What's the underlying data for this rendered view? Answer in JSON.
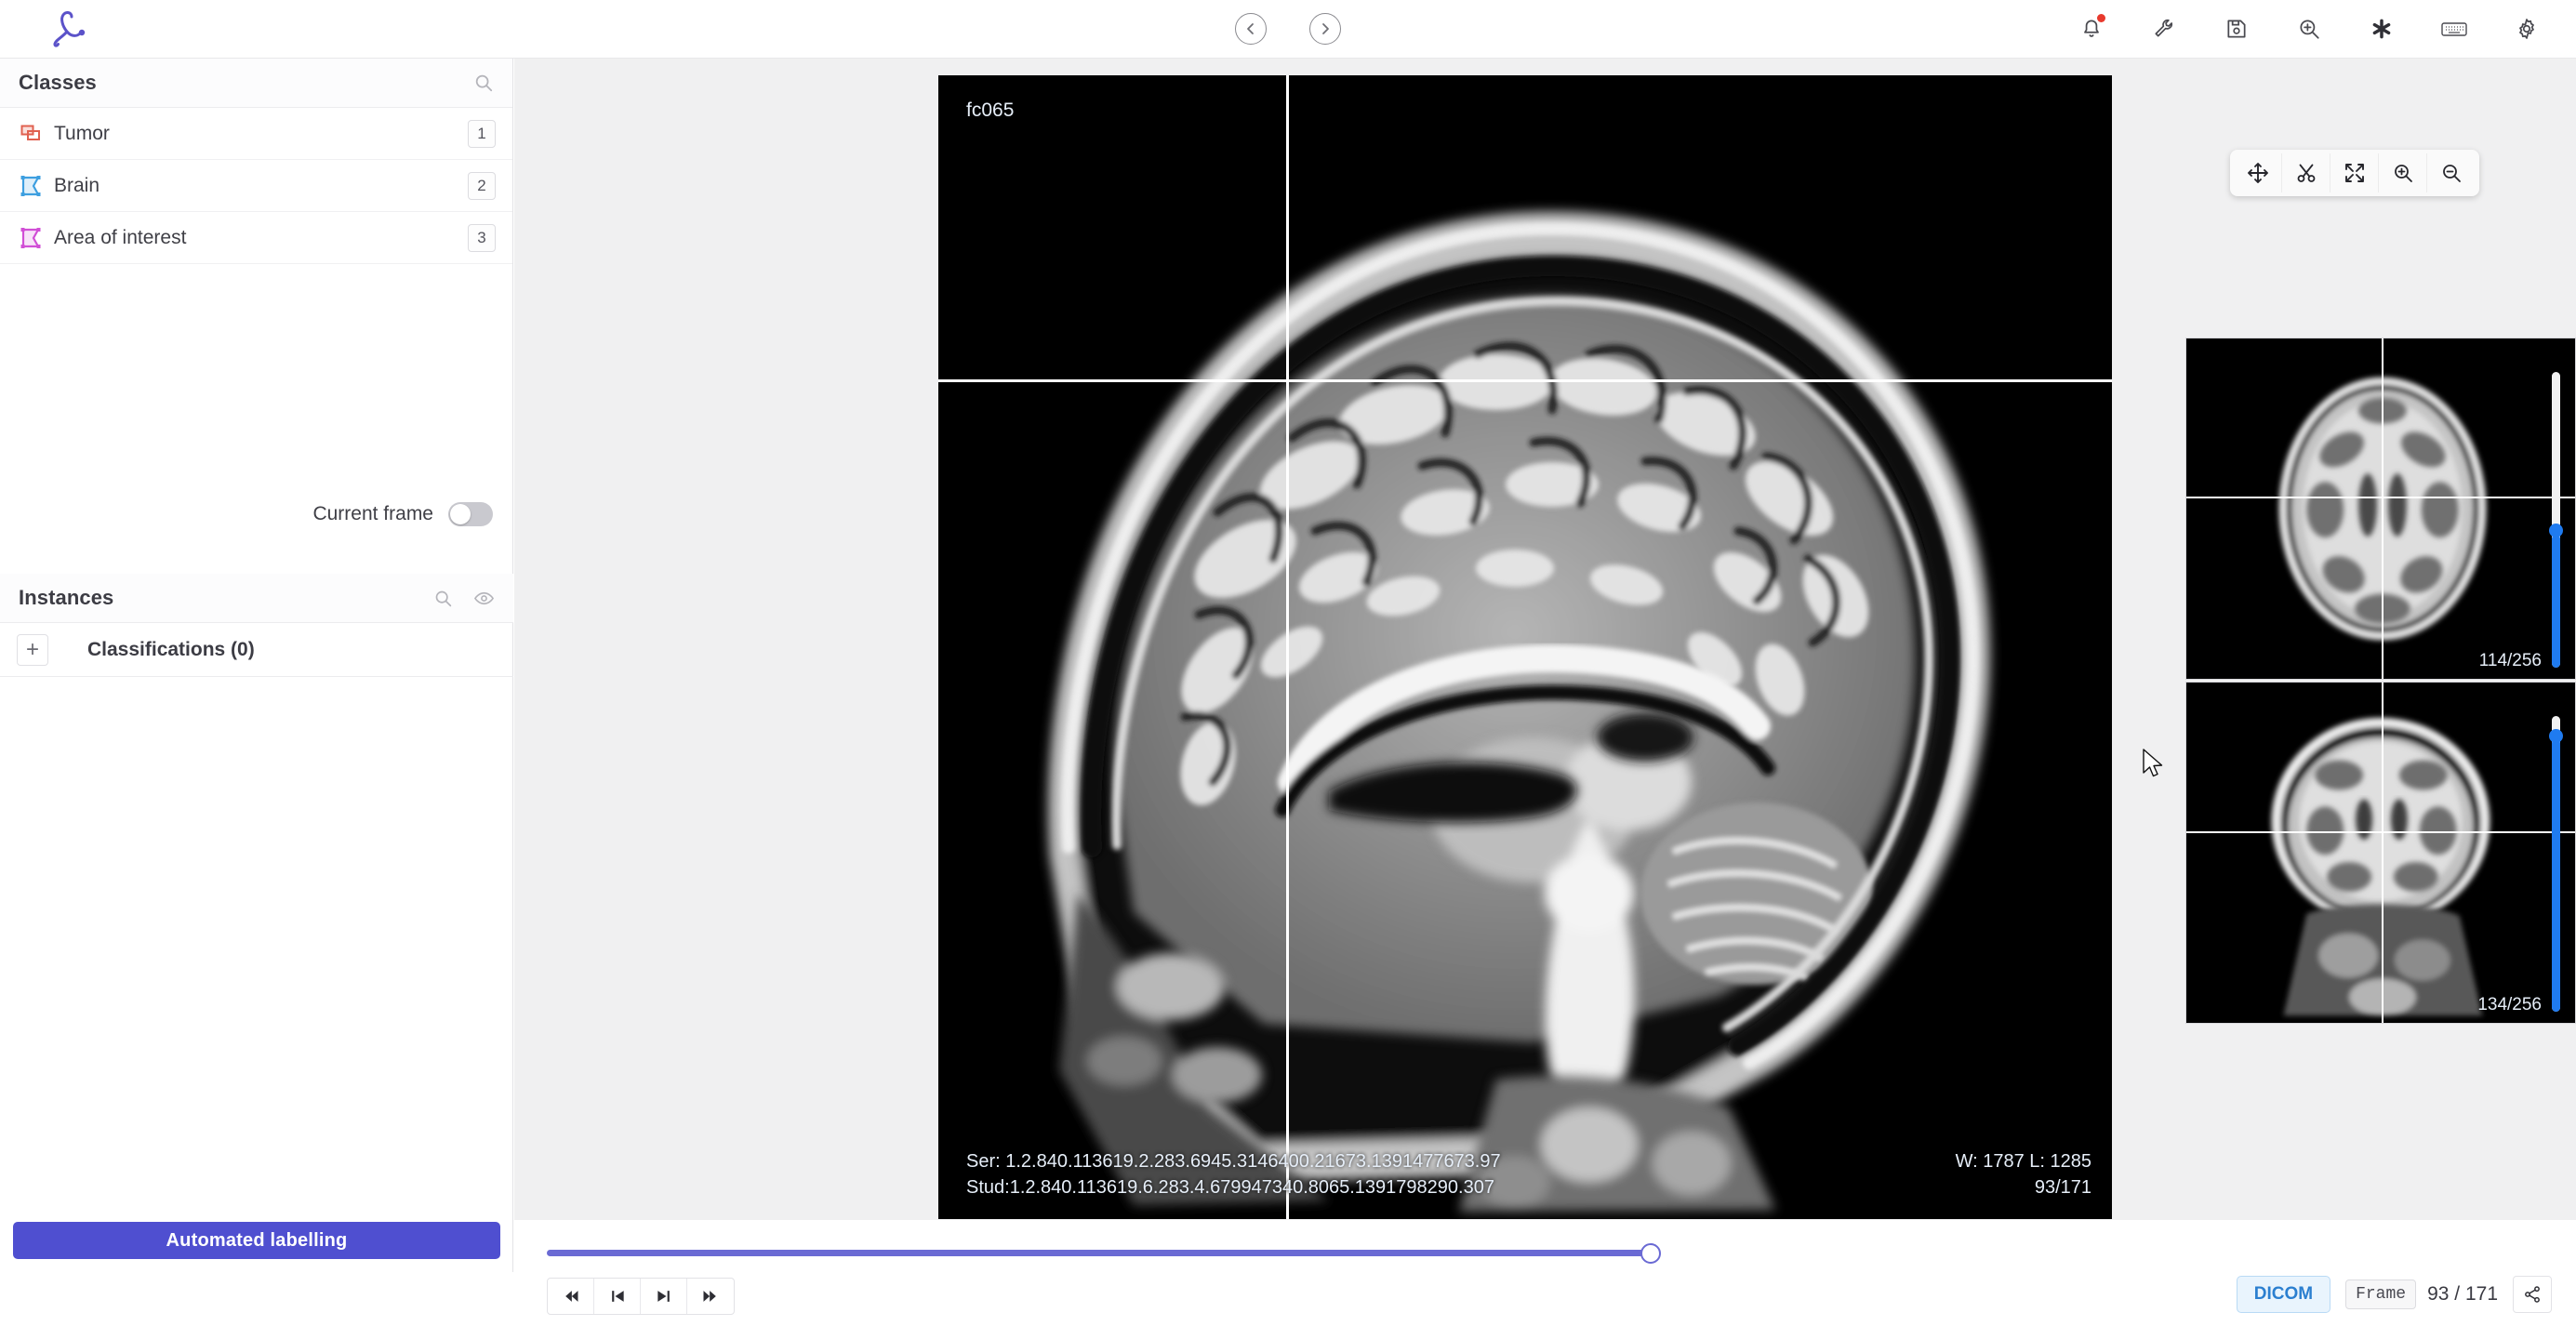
{
  "app": {
    "logo_name": "encord-logo",
    "accent_purple": "#4f4fd0",
    "accent_blue": "#1f7bf0",
    "chip_blue": "#2b7fd0"
  },
  "topbar": {
    "nav_prev_icon": "chevron-left-circle-icon",
    "nav_next_icon": "chevron-right-circle-icon",
    "icons": [
      {
        "name": "bell-icon",
        "has_badge": true
      },
      {
        "name": "wrench-icon",
        "has_badge": false
      },
      {
        "name": "save-icon",
        "has_badge": false
      },
      {
        "name": "zoom-in-icon",
        "has_badge": false
      },
      {
        "name": "asterisk-icon",
        "has_badge": false
      },
      {
        "name": "keyboard-icon",
        "has_badge": false
      },
      {
        "name": "gear-icon",
        "has_badge": false
      }
    ]
  },
  "sidebar": {
    "classes": {
      "title": "Classes",
      "search_icon": "search-icon",
      "items": [
        {
          "label": "Tumor",
          "count": "1",
          "icon": "bounding-box-icon",
          "color": "#e0604f"
        },
        {
          "label": "Brain",
          "count": "2",
          "icon": "polygon-icon",
          "color": "#3d9fe0"
        },
        {
          "label": "Area of interest",
          "count": "3",
          "icon": "polygon-icon",
          "color": "#d14fd6"
        }
      ]
    },
    "current_frame": {
      "label": "Current frame",
      "enabled": false
    },
    "instances": {
      "title": "Instances",
      "search_icon": "search-icon",
      "visibility_icon": "eye-icon",
      "add_icon": "plus-icon",
      "classifications_label": "Classifications (0)"
    },
    "automated_labelling_label": "Automated labelling"
  },
  "viewer": {
    "image_label": "fc065",
    "series_uid": "Ser: 1.2.840.113619.2.283.6945.3146400.21673.1391477673.97",
    "study_uid": "Stud:1.2.840.113619.6.283.4.679947340.8065.1391798290.307",
    "window_level": "W: 1787 L: 1285",
    "slice_counter": "93/171",
    "tools": [
      {
        "name": "move-icon",
        "label": "Move"
      },
      {
        "name": "scissors-icon",
        "label": "Cut"
      },
      {
        "name": "fit-screen-icon",
        "label": "Fit"
      },
      {
        "name": "zoom-in-icon",
        "label": "Zoom in"
      },
      {
        "name": "zoom-out-icon",
        "label": "Zoom out"
      }
    ]
  },
  "thumbnails": [
    {
      "name": "axial-thumbnail",
      "counter": "114/256",
      "slider_percent": 45
    },
    {
      "name": "coronal-thumbnail",
      "counter": "134/256",
      "slider_percent": 92
    }
  ],
  "bottombar": {
    "timeline_percent": 55,
    "transport": [
      {
        "name": "skip-to-start-button",
        "icon": "skip-back-icon"
      },
      {
        "name": "previous-frame-button",
        "icon": "step-back-icon"
      },
      {
        "name": "next-frame-button",
        "icon": "step-forward-icon"
      },
      {
        "name": "skip-to-end-button",
        "icon": "skip-forward-icon"
      }
    ],
    "dicom_label": "DICOM",
    "frame_label": "Frame",
    "frame_value": "93 / 171",
    "share_icon": "share-icon"
  }
}
